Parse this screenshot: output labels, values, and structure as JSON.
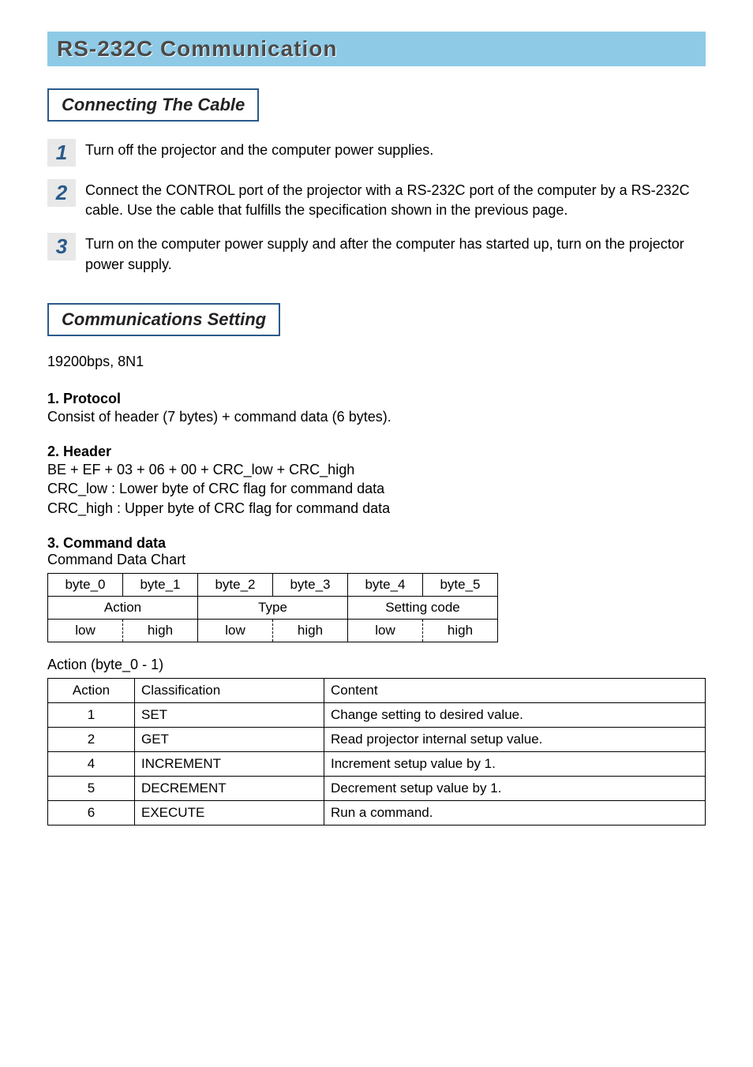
{
  "title": "RS-232C Communication",
  "section1": {
    "heading": "Connecting The Cable",
    "steps": [
      {
        "num": "1",
        "text": "Turn off the projector and the computer power supplies."
      },
      {
        "num": "2",
        "text": "Connect the CONTROL port of the projector with a RS-232C port of the computer by a RS-232C cable. Use the cable that fulfills the specification shown in the previous page."
      },
      {
        "num": "3",
        "text": "Turn on the computer power supply and after the computer has started up, turn on the projector power supply."
      }
    ]
  },
  "section2": {
    "heading": "Communications Setting",
    "rate": "19200bps, 8N1",
    "protocol_head": "1. Protocol",
    "protocol_body": "Consist of header (7 bytes) + command data (6 bytes).",
    "header_head": "2. Header",
    "header_line1": "BE + EF + 03 + 06 + 00 + CRC_low + CRC_high",
    "header_line2": "CRC_low : Lower byte of CRC flag for command data",
    "header_line3": "CRC_high : Upper byte of CRC flag for command data",
    "cmd_head": "3. Command data",
    "cmd_caption": "Command Data Chart",
    "cmd_table": {
      "row1": [
        "byte_0",
        "byte_1",
        "byte_2",
        "byte_3",
        "byte_4",
        "byte_5"
      ],
      "row2": [
        "Action",
        "Type",
        "Setting code"
      ],
      "row3": [
        "low",
        "high",
        "low",
        "high",
        "low",
        "high"
      ]
    },
    "action_caption": "Action (byte_0 - 1)",
    "action_headers": [
      "Action",
      "Classification",
      "Content"
    ],
    "action_rows": [
      {
        "a": "1",
        "c": "SET",
        "d": "Change setting to desired value."
      },
      {
        "a": "2",
        "c": "GET",
        "d": "Read projector internal setup value."
      },
      {
        "a": "4",
        "c": "INCREMENT",
        "d": "Increment setup value by 1."
      },
      {
        "a": "5",
        "c": "DECREMENT",
        "d": "Decrement setup value by 1."
      },
      {
        "a": "6",
        "c": "EXECUTE",
        "d": "Run a command."
      }
    ]
  }
}
